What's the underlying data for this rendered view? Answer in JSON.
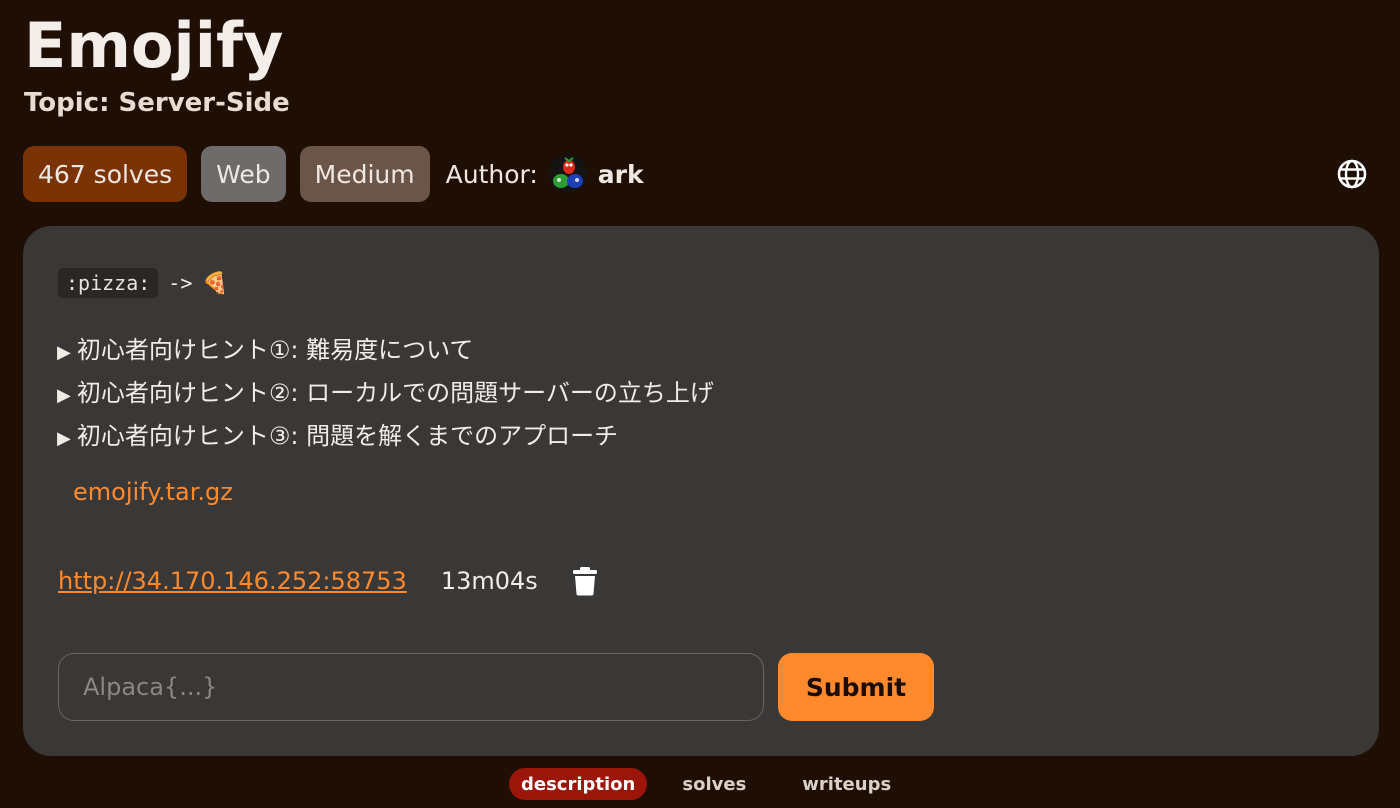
{
  "challenge": {
    "title": "Emojify",
    "topic": "Topic: Server-Side"
  },
  "badges": {
    "solves": "467 solves",
    "category": "Web",
    "difficulty": "Medium"
  },
  "author": {
    "label": "Author:",
    "name": "ark"
  },
  "description": {
    "code": ":pizza:",
    "arrow": "->",
    "emoji": "🍕",
    "hints": [
      "初心者向けヒント①: 難易度について",
      "初心者向けヒント②: ローカルでの問題サーバーの立ち上げ",
      "初心者向けヒント③: 問題を解くまでのアプローチ"
    ],
    "file": "emojify.tar.gz"
  },
  "instance": {
    "url": "http://34.170.146.252:58753",
    "timer": "13m04s"
  },
  "flag": {
    "placeholder": "Alpaca{...}",
    "submit_label": "Submit"
  },
  "tabs": [
    {
      "label": "description",
      "active": true
    },
    {
      "label": "solves",
      "active": false
    },
    {
      "label": "writeups",
      "active": false
    }
  ],
  "icons": {
    "globe": "globe-icon",
    "trash": "trash-icon",
    "disclosure": "triangle-right-icon",
    "avatar": "avatar"
  },
  "colors": {
    "background": "#1f0e04",
    "card": "#3a3737",
    "accent": "#ff8a2e",
    "solves_badge": "#7a3304",
    "category_badge": "#6e6b6b",
    "difficulty_badge": "#6b5448",
    "active_tab": "#9b1608"
  }
}
